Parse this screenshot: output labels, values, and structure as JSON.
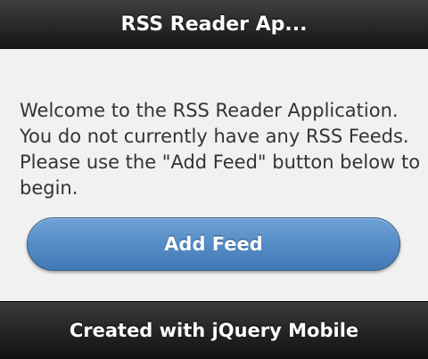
{
  "header": {
    "title": "RSS Reader Ap..."
  },
  "content": {
    "welcome_text": "Welcome to the RSS Reader Application. You do not currently have any RSS Feeds. Please use the \"Add Feed\" button below to begin."
  },
  "actions": {
    "add_feed_label": "Add Feed"
  },
  "footer": {
    "text": "Created with jQuery Mobile"
  },
  "colors": {
    "header_bg": "#1f1f1f",
    "page_bg": "#f1f1f1",
    "button_bg": "#4f88c4",
    "footer_bg": "#1f1f1f"
  }
}
